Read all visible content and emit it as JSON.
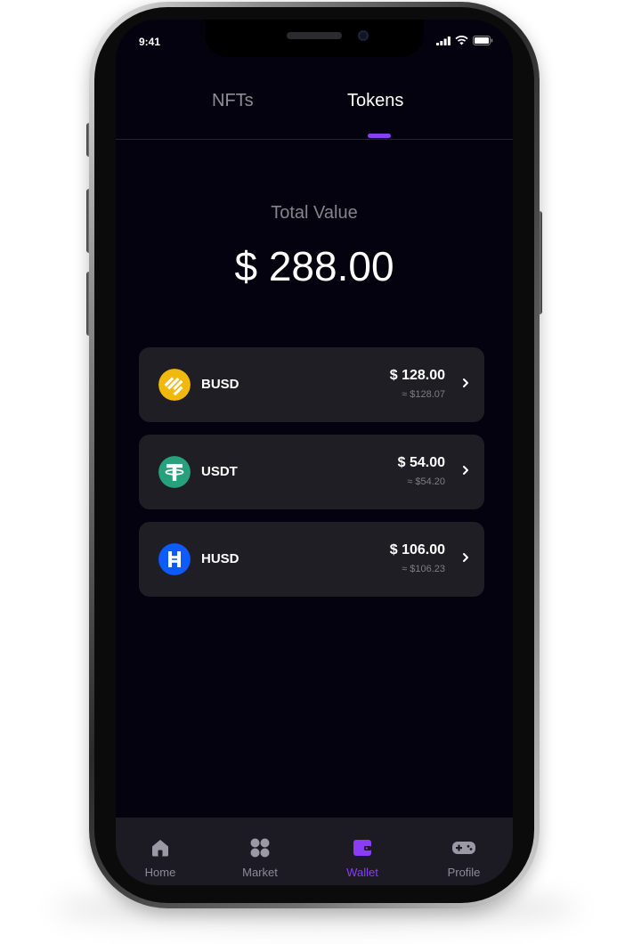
{
  "status_bar": {
    "time": "9:41"
  },
  "tabs": [
    {
      "label": "NFTs",
      "active": false
    },
    {
      "label": "Tokens",
      "active": true
    }
  ],
  "total": {
    "label": "Total Value",
    "value": "$ 288.00"
  },
  "tokens": [
    {
      "name": "BUSD",
      "amount": "$ 128.00",
      "approx": "≈ $128.07",
      "icon": "busd-icon",
      "color": "#F0B90B"
    },
    {
      "name": "USDT",
      "amount": "$ 54.00",
      "approx": "≈ $54.20",
      "icon": "usdt-icon",
      "color": "#26A17B"
    },
    {
      "name": "HUSD",
      "amount": "$ 106.00",
      "approx": "≈ $106.23",
      "icon": "husd-icon",
      "color": "#0D5BFF"
    }
  ],
  "bottom_nav": [
    {
      "label": "Home",
      "icon": "home-icon",
      "active": false
    },
    {
      "label": "Market",
      "icon": "market-icon",
      "active": false
    },
    {
      "label": "Wallet",
      "icon": "wallet-icon",
      "active": true
    },
    {
      "label": "Profile",
      "icon": "gamepad-icon",
      "active": false
    }
  ],
  "colors": {
    "accent": "#8A3DF6",
    "background": "#04020F",
    "card": "#1F1E24",
    "nav": "#1C1B23"
  }
}
